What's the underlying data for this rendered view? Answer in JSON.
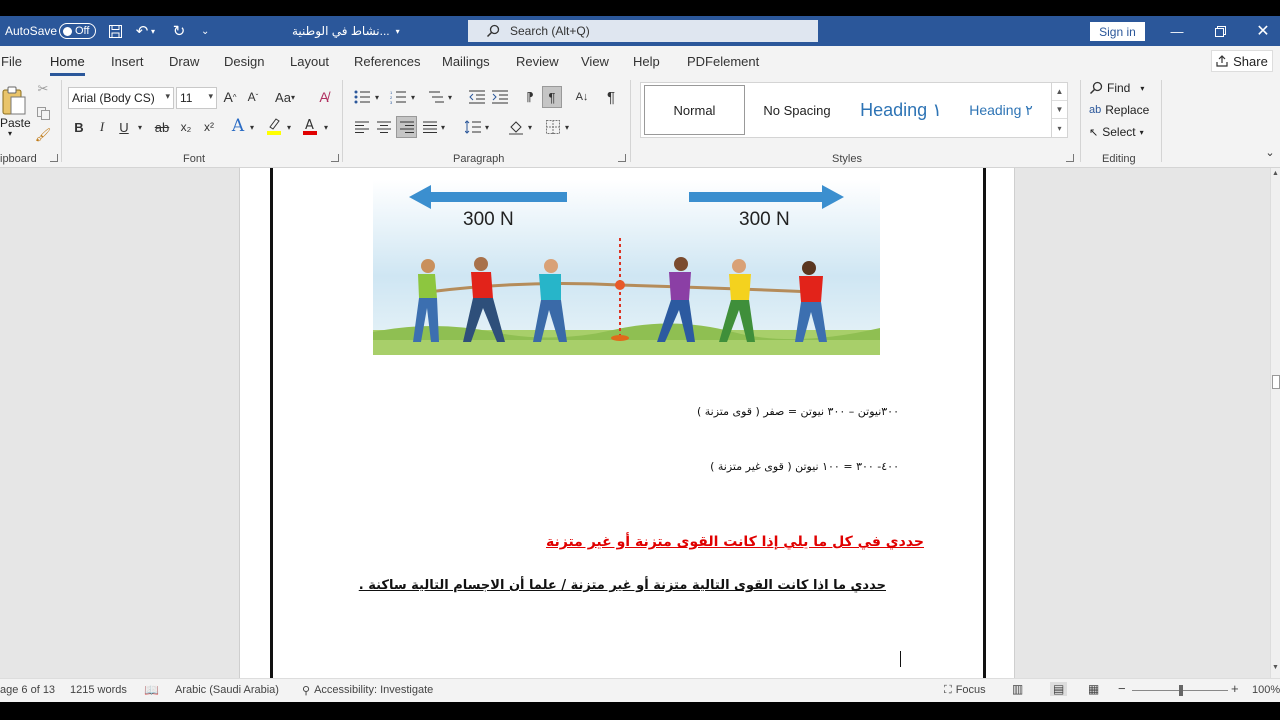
{
  "titlebar": {
    "autosave_label": "AutoSave",
    "autosave_state": "Off",
    "doc_title": "نشاط في الوطنية...",
    "search_placeholder": "Search (Alt+Q)",
    "signin_label": "Sign in"
  },
  "menu": {
    "tabs": [
      "File",
      "Home",
      "Insert",
      "Draw",
      "Design",
      "Layout",
      "References",
      "Mailings",
      "Review",
      "View",
      "Help",
      "PDFelement"
    ],
    "active": "Home",
    "share_label": "Share"
  },
  "ribbon": {
    "clipboard": {
      "paste_label": "Paste",
      "group_label": "ipboard"
    },
    "font": {
      "family": "Arial (Body CS)",
      "size": "11",
      "group_label": "Font",
      "bold": "B",
      "italic": "I",
      "underline": "U",
      "strike": "ab",
      "subscript": "x₂",
      "superscript": "x²",
      "aa_label": "Aa",
      "font_color": "#e00000",
      "highlight_color": "#ffff00"
    },
    "paragraph": {
      "group_label": "Paragraph"
    },
    "styles": {
      "items": [
        "Normal",
        "No Spacing",
        "Heading ١",
        "Heading ٢"
      ],
      "group_label": "Styles"
    },
    "editing": {
      "find_label": "Find",
      "replace_label": "Replace",
      "select_label": "Select",
      "group_label": "Editing"
    }
  },
  "document": {
    "figure": {
      "left_force": "300 N",
      "right_force": "300 N"
    },
    "equation1": "٣٠٠نيوتن – ٣٠٠ نيوتن = صفر ( قوى متزنة )",
    "equation2": "٤٠٠- ٣٠٠ = ١٠٠ نيوتن ( قوى غير متزنة )",
    "question1": "حددي في كل ما يلي إذا كانت القوى متزنة أو غير متزنة",
    "question2": "حددي ما اذا كانت القوى التالية متزنة أو غير متزنة / علما أن الاجسام التالية ساكنة ."
  },
  "status": {
    "page": "age 6 of 13",
    "words": "1215 words",
    "language": "Arabic (Saudi Arabia)",
    "accessibility": "Accessibility: Investigate",
    "focus": "Focus",
    "zoom": "100%"
  }
}
